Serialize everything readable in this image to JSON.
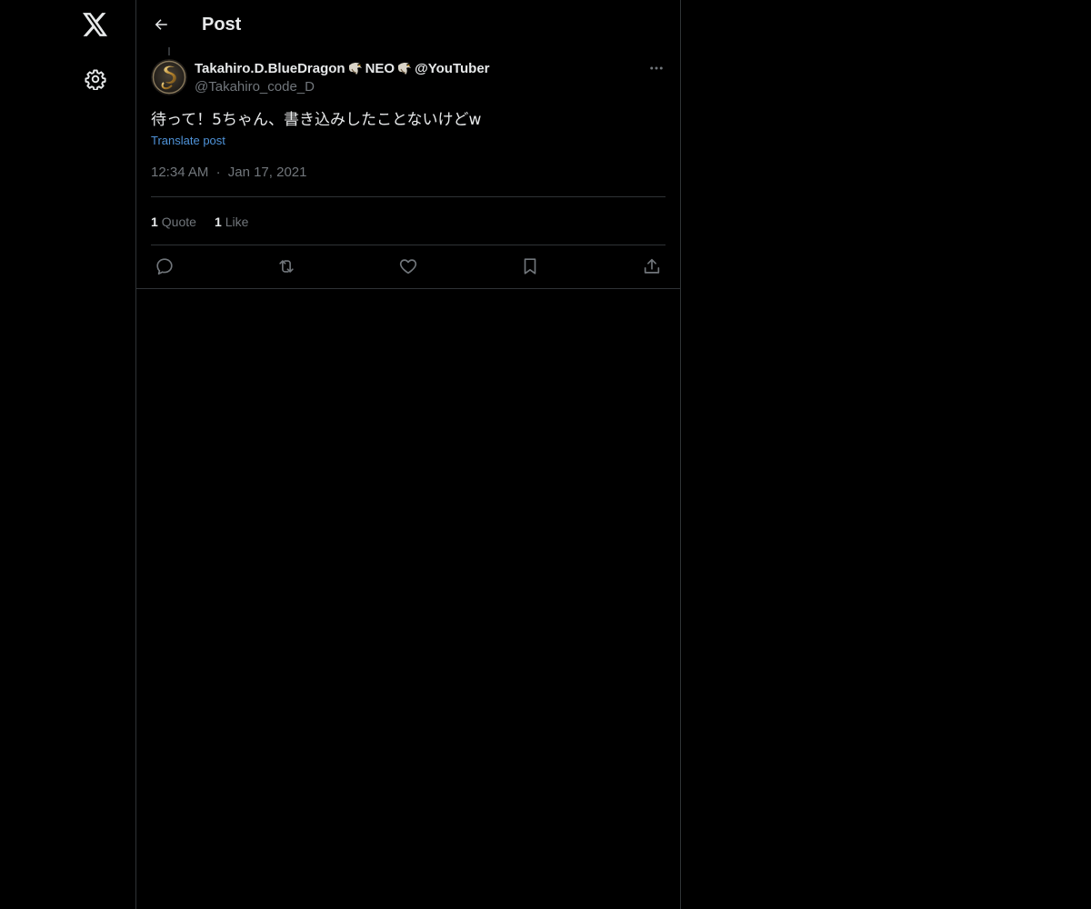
{
  "header": {
    "title": "Post"
  },
  "post": {
    "author": {
      "display_name_part1": "Takahiro.D.BlueDragon",
      "display_name_part2": "NEO",
      "display_name_part3": "@YouTuber",
      "handle": "@Takahiro_code_D"
    },
    "text": "待って！5ちゃん、書き込みしたことないけどw",
    "translate_label": "Translate post",
    "time": "12:34 AM",
    "separator": "·",
    "date": "Jan 17, 2021",
    "stats": {
      "quotes_count": "1",
      "quotes_label": "Quote",
      "likes_count": "1",
      "likes_label": "Like"
    }
  },
  "icons": {
    "logo": "x-logo-icon",
    "settings": "gear-icon",
    "back": "arrow-left-icon",
    "more": "more-horizontal-icon",
    "reply": "reply-icon",
    "repost": "repost-icon",
    "like": "heart-icon",
    "bookmark": "bookmark-icon",
    "share": "share-icon",
    "name_emoji": "eagle-emoji-icon"
  },
  "colors": {
    "background": "#000000",
    "text_primary": "#e7e9ea",
    "text_secondary": "#71767b",
    "link": "#4f93d9",
    "border": "#2f3336"
  }
}
